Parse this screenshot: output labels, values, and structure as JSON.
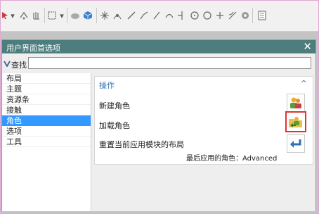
{
  "toolbar": {
    "icons": [
      "selection-filter-icon",
      "snap-icon",
      "hand-icon",
      "rectangle-select-icon",
      "shaded-view-icon",
      "solid-cube-icon",
      "grid-icon",
      "point-on-curve-icon",
      "line-icon",
      "arc-icon",
      "point-icon",
      "circle-icon",
      "plus-icon",
      "tangent-icon",
      "settings-icon",
      "sheet-icon"
    ]
  },
  "dialog": {
    "title": "用户界面首选项",
    "close": "✕",
    "find_label": "查找",
    "find_value": ""
  },
  "sidebar": {
    "items": [
      "布局",
      "主题",
      "资源条",
      "接触",
      "角色",
      "选项",
      "工具"
    ],
    "selected": "角色"
  },
  "section": {
    "title": "操作",
    "collapse": "^",
    "rows": [
      "新建角色",
      "加载角色",
      "重置当前应用模块的布局"
    ],
    "last_role": "最后应用的角色：Advanced"
  },
  "colors": {
    "title_bar": "#4e7d7d",
    "selection": "#3399ff",
    "accent": "#2f6fb4",
    "highlight_border": "#e23232"
  }
}
